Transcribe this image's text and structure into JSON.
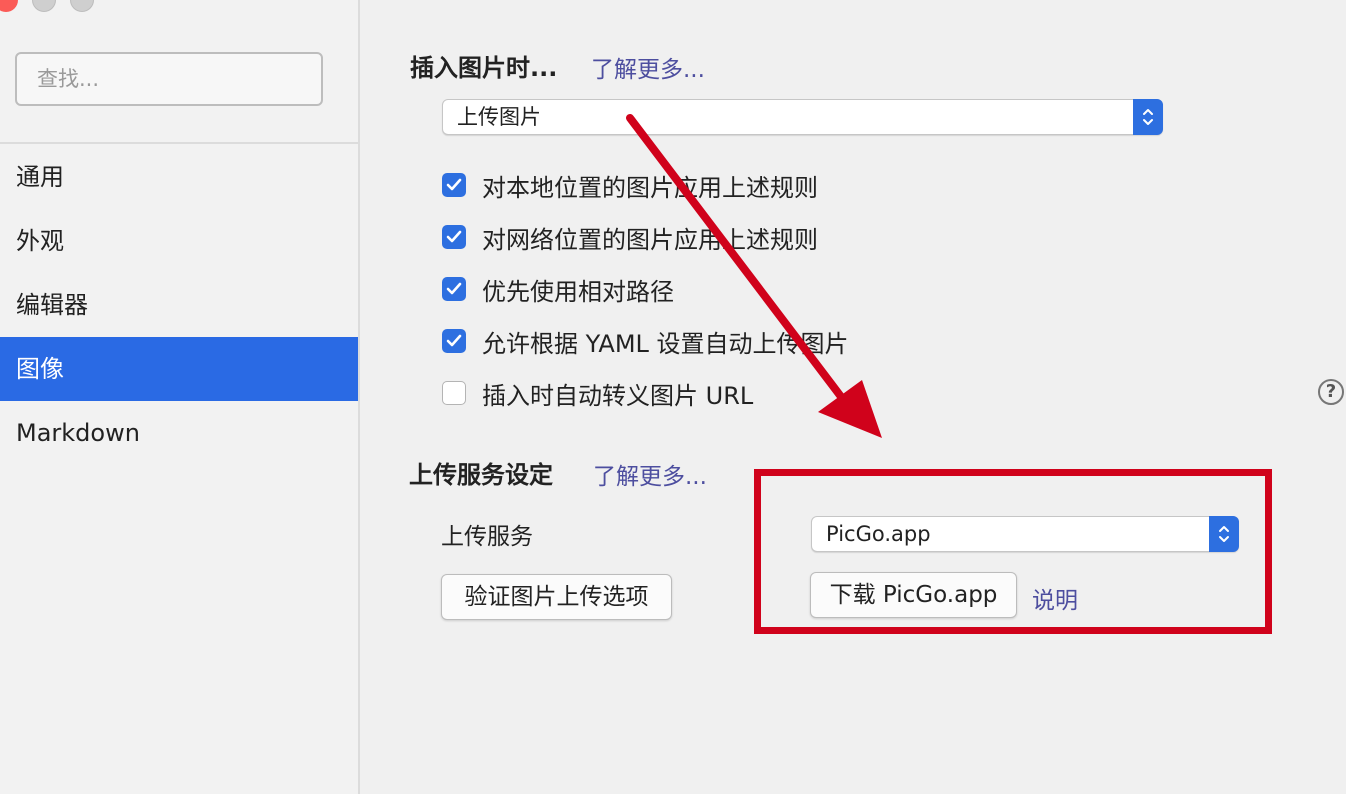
{
  "sidebar": {
    "search_placeholder": "查找...",
    "items": [
      {
        "label": "通用",
        "active": false
      },
      {
        "label": "外观",
        "active": false
      },
      {
        "label": "编辑器",
        "active": false
      },
      {
        "label": "图像",
        "active": true
      },
      {
        "label": "Markdown",
        "active": false
      }
    ]
  },
  "insert_section": {
    "title": "插入图片时...",
    "more_link": "了解更多...",
    "select_value": "上传图片",
    "options": [
      {
        "label": "对本地位置的图片应用上述规则",
        "checked": true
      },
      {
        "label": "对网络位置的图片应用上述规则",
        "checked": true
      },
      {
        "label": "优先使用相对路径",
        "checked": true
      },
      {
        "label": "允许根据 YAML 设置自动上传图片",
        "checked": true
      },
      {
        "label": "插入时自动转义图片 URL",
        "checked": false
      }
    ],
    "help_icon": "question-circle-icon"
  },
  "upload_section": {
    "title": "上传服务设定",
    "more_link": "了解更多...",
    "service_label": "上传服务",
    "service_value": "PicGo.app",
    "verify_button": "验证图片上传选项",
    "download_button": "下载 PicGo.app",
    "help_link": "说明"
  },
  "colors": {
    "accent": "#2a6ae4",
    "link": "#4d4e9f",
    "annotation": "#d0021b"
  }
}
